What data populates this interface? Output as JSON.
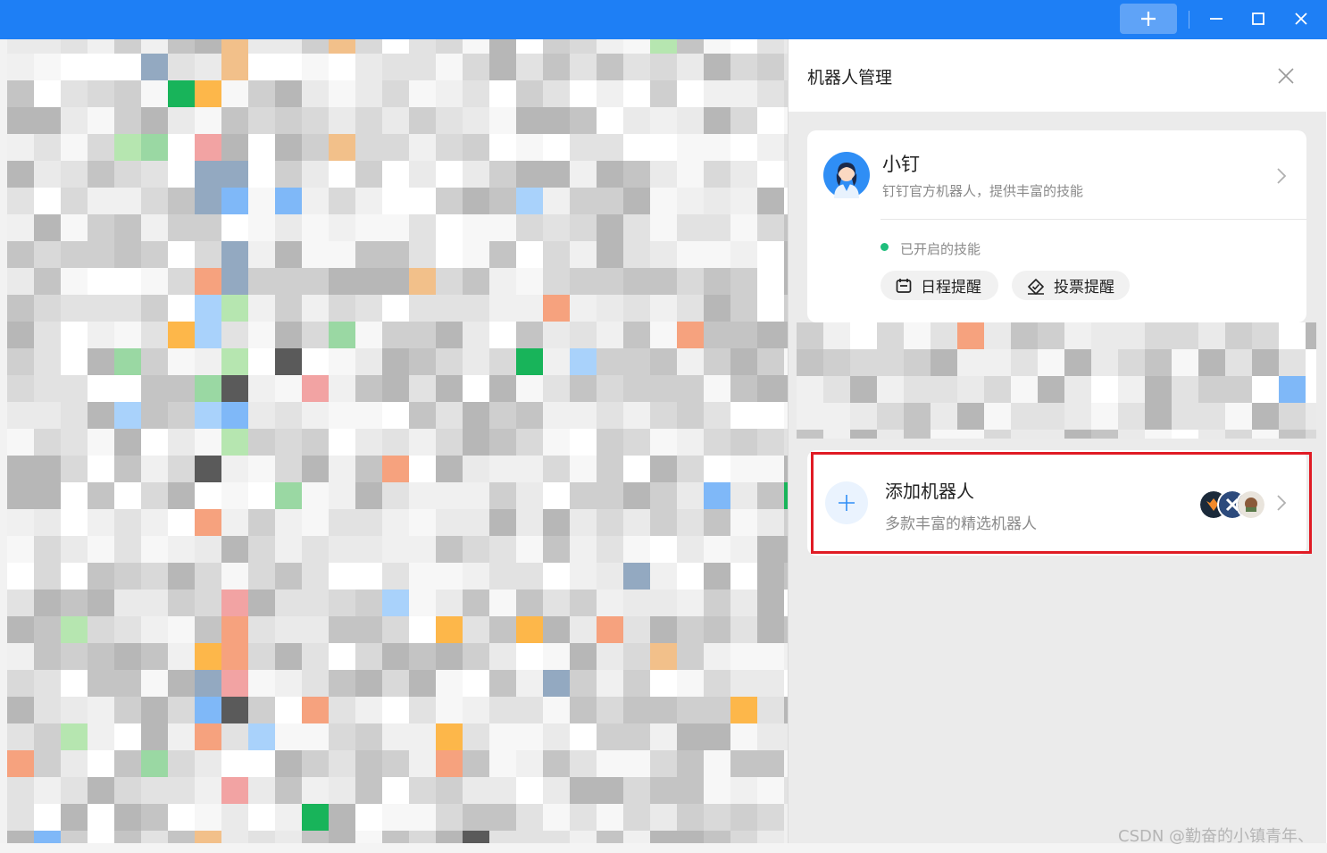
{
  "colors": {
    "titlebar": "#1e7ff5",
    "accent": "#1e7ff5",
    "highlight_border": "#e01b24",
    "active_dot": "#1fbe7c"
  },
  "titlebar": {
    "add_icon": "plus-icon",
    "minimize_icon": "minimize-icon",
    "maximize_icon": "maximize-icon",
    "close_icon": "close-icon"
  },
  "panel": {
    "title": "机器人管理",
    "close_icon": "close-icon"
  },
  "bot": {
    "name": "小钉",
    "description": "钉钉官方机器人，提供丰富的技能",
    "skills_label": "已开启的技能",
    "skills": [
      {
        "label": "日程提醒",
        "icon": "calendar-icon"
      },
      {
        "label": "投票提醒",
        "icon": "vote-icon"
      }
    ]
  },
  "add_robot": {
    "title": "添加机器人",
    "subtitle": "多款丰富的精选机器人",
    "icon": "plus-icon"
  },
  "watermark": "CSDN @勤奋的小镇青年、"
}
